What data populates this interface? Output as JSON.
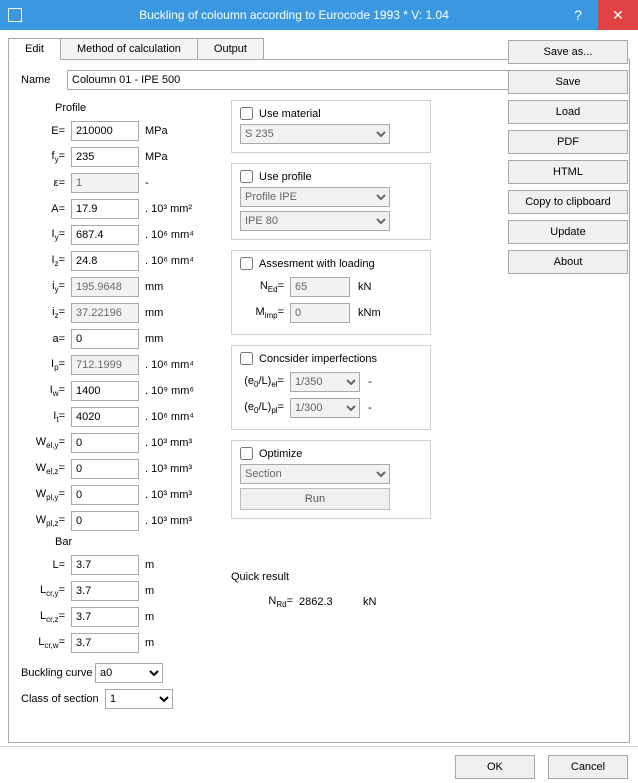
{
  "window": {
    "title": "Buckling of coloumn according to Eurocode 1993 * V: 1.04",
    "help": "?",
    "close": "✕"
  },
  "tabs": {
    "edit": "Edit",
    "method": "Method of calculation",
    "output": "Output"
  },
  "name_label": "Name",
  "name_value": "Coloumn 01 - IPE 500",
  "profile": {
    "heading": "Profile",
    "E": {
      "label": "E=",
      "value": "210000",
      "unit": "MPa"
    },
    "fy": {
      "label": "f_y=",
      "value": "235",
      "unit": "MPa"
    },
    "eps": {
      "label": "ε=",
      "value": "1",
      "unit": "-"
    },
    "A": {
      "label": "A=",
      "value": "17.9",
      "unit": ". 10³ mm²"
    },
    "Iy": {
      "label": "I_y=",
      "value": "687.4",
      "unit": ". 10⁶ mm⁴"
    },
    "Iz": {
      "label": "I_z=",
      "value": "24.8",
      "unit": ". 10⁶ mm⁴"
    },
    "iy": {
      "label": "i_y=",
      "value": "195.9648",
      "unit": "mm"
    },
    "iz": {
      "label": "i_z=",
      "value": "37.22196",
      "unit": "mm"
    },
    "a": {
      "label": "a=",
      "value": "0",
      "unit": "mm"
    },
    "Ip": {
      "label": "I_p=",
      "value": "712.1999",
      "unit": ". 10⁶ mm⁴"
    },
    "Iw": {
      "label": "I_w=",
      "value": "1400",
      "unit": ". 10⁹ mm⁶"
    },
    "It": {
      "label": "I_t=",
      "value": "4020",
      "unit": ". 10⁶ mm⁴"
    },
    "Wely": {
      "label": "W_el,y=",
      "value": "0",
      "unit": ". 10³ mm³"
    },
    "Welz": {
      "label": "W_el,z=",
      "value": "0",
      "unit": ". 10³ mm³"
    },
    "Wply": {
      "label": "W_pl,y=",
      "value": "0",
      "unit": ". 10³ mm³"
    },
    "Wplz": {
      "label": "W_pl,z=",
      "value": "0",
      "unit": ". 10³ mm³"
    }
  },
  "bar": {
    "heading": "Bar",
    "L": {
      "label": "L=",
      "value": "3.7",
      "unit": "m"
    },
    "Lcry": {
      "label": "L_cr,y=",
      "value": "3.7",
      "unit": "m"
    },
    "Lcrz": {
      "label": "L_cr,z=",
      "value": "3.7",
      "unit": "m"
    },
    "Lcrw": {
      "label": "L_cr,w=",
      "value": "3.7",
      "unit": "m"
    }
  },
  "buckling_curve": {
    "label": "Buckling curve",
    "value": "a0"
  },
  "class_section": {
    "label": "Class of section",
    "value": "1"
  },
  "mid": {
    "use_material": {
      "label": "Use material",
      "select": "S 235"
    },
    "use_profile": {
      "label": "Use profile",
      "select1": "Profile IPE",
      "select2": "IPE 80"
    },
    "assessment": {
      "label": "Assesment with loading",
      "NEd": {
        "label": "N_Ed=",
        "value": "65",
        "unit": "kN"
      },
      "Mimp": {
        "label": "M_imp=",
        "value": "0",
        "unit": "kNm"
      }
    },
    "imperf": {
      "label": "Concsider imperfections",
      "e0el": {
        "label": "(e₀/L)_el=",
        "value": "1/350",
        "unit": "-"
      },
      "e0pl": {
        "label": "(e₀/L)_pl=",
        "value": "1/300",
        "unit": "-"
      }
    },
    "optimize": {
      "label": "Optimize",
      "target": "Section",
      "run": "Run"
    },
    "quick": {
      "heading": "Quick result",
      "NRd_label": "N_Rd=",
      "NRd_value": "2862.3",
      "NRd_unit": "kN"
    }
  },
  "side": {
    "save_as": "Save as...",
    "save": "Save",
    "load": "Load",
    "pdf": "PDF",
    "html": "HTML",
    "copy": "Copy to clipboard",
    "update": "Update",
    "about": "About"
  },
  "footer": {
    "ok": "OK",
    "cancel": "Cancel"
  }
}
